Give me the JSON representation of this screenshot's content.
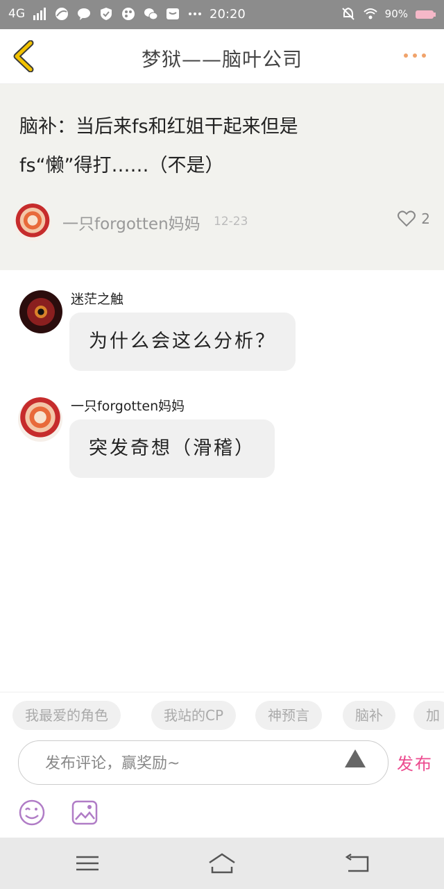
{
  "status_bar": {
    "network": "4G",
    "time": "20:20",
    "battery": "90%",
    "icons_left": [
      "signal-icon",
      "browser-icon",
      "chat-icon",
      "shield-icon",
      "palette-icon",
      "wechat-icon",
      "mail-icon",
      "more-dots-icon"
    ],
    "icons_right": [
      "mute-icon",
      "wifi-icon",
      "battery-icon"
    ]
  },
  "header": {
    "title": "梦狱——脑叶公司",
    "back_icon": "chevron-left-icon",
    "more_icon": "more-dots-icon"
  },
  "post": {
    "line1": "脑补：当后来fs和红姐干起来但是",
    "line2": "fs“懒”得打……（不是）",
    "author": "一只forgotten妈妈",
    "date": "12-23",
    "likes": "2"
  },
  "comments": [
    {
      "author": "迷茫之触",
      "text": "为什么会这么分析？"
    },
    {
      "author": "一只forgotten妈妈",
      "text": "突发奇想（滑稽）"
    }
  ],
  "tags": [
    "我最爱的角色",
    "我站的CP",
    "神预言",
    "脑补",
    "加"
  ],
  "composer": {
    "placeholder": "发布评论，赢奖励~",
    "publish_label": "发布"
  },
  "colors": {
    "accent": "#ec4b8f",
    "back_arrow": "#f2c200",
    "more_dots": "#f0a36b",
    "post_bg": "#f2f2ee"
  }
}
